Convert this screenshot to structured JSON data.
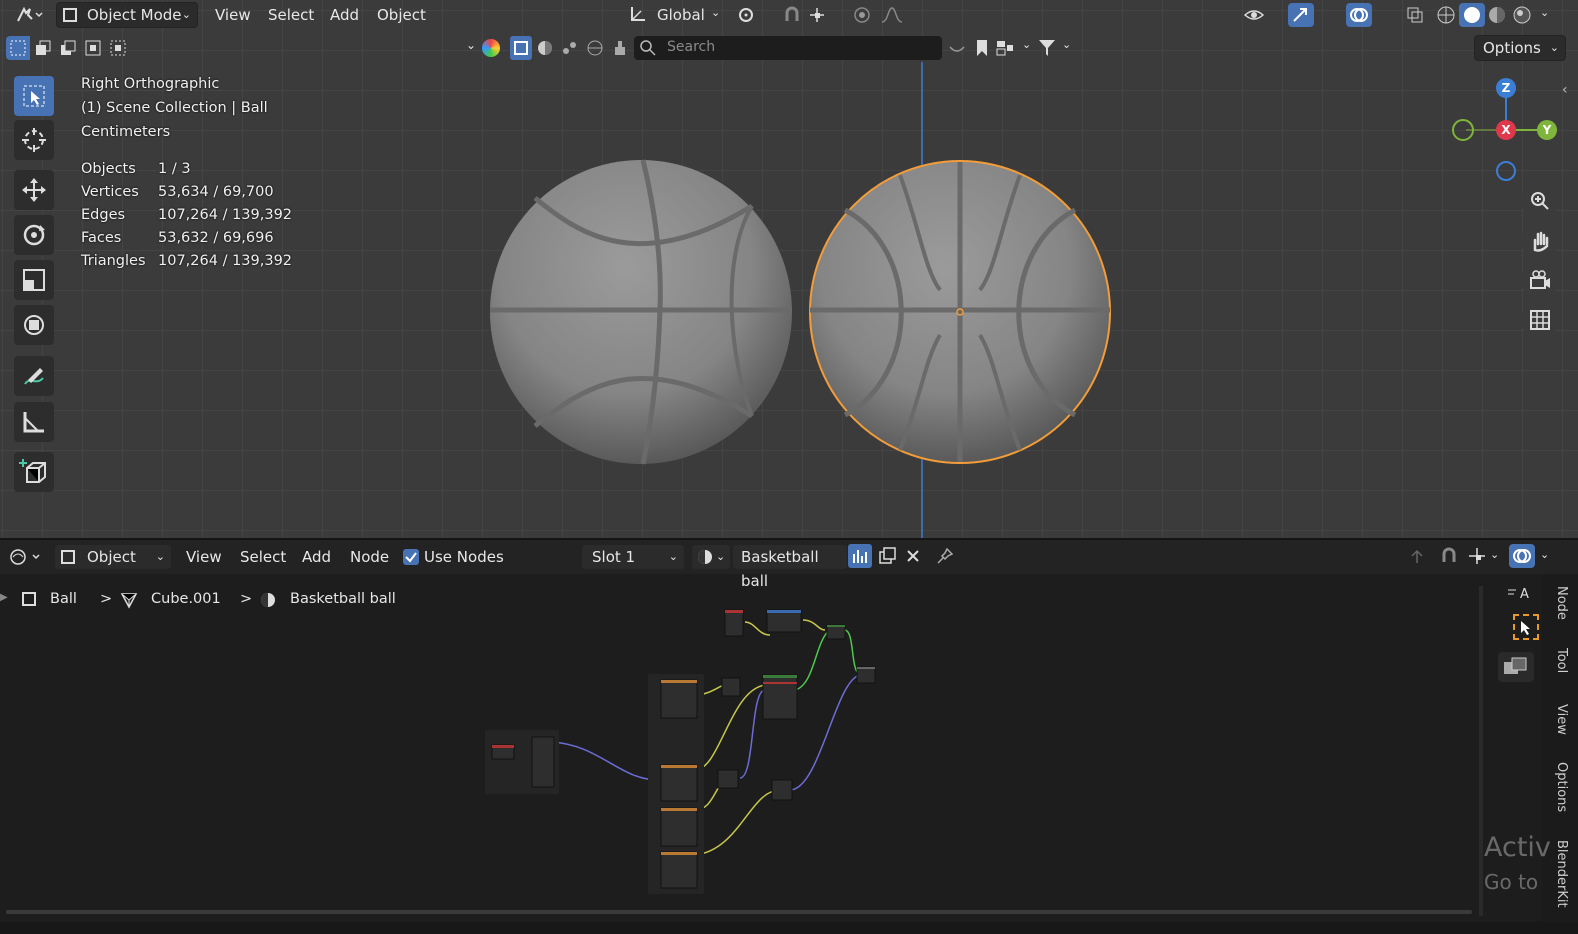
{
  "viewport": {
    "header": {
      "mode": "Object Mode",
      "menus": [
        "View",
        "Select",
        "Add",
        "Object"
      ],
      "orientation": "Global",
      "options_label": "Options",
      "search_placeholder": "Search"
    },
    "overlay": {
      "view_name": "Right Orthographic",
      "collection": "(1) Scene Collection | Ball",
      "units": "Centimeters",
      "stats": [
        {
          "label": "Objects",
          "value": "1 / 3"
        },
        {
          "label": "Vertices",
          "value": "53,634 / 69,700"
        },
        {
          "label": "Edges",
          "value": "107,264 / 139,392"
        },
        {
          "label": "Faces",
          "value": "53,632 / 69,696"
        },
        {
          "label": "Triangles",
          "value": "107,264 / 139,392"
        }
      ]
    },
    "gizmo": {
      "z": "Z",
      "x": "X",
      "y": "Y"
    },
    "colors": {
      "selection": "#f29c3a",
      "active_tool": "#4772b3",
      "axis_x": "#e0384b",
      "axis_y": "#7fb53a",
      "axis_z": "#3b7ed6"
    }
  },
  "node_editor": {
    "header": {
      "context": "Object",
      "menus": [
        "View",
        "Select",
        "Add",
        "Node"
      ],
      "use_nodes_label": "Use Nodes",
      "use_nodes_checked": true,
      "slot": "Slot 1",
      "material": "Basketball ball"
    },
    "breadcrumb": {
      "object": "Ball",
      "mesh": "Cube.001",
      "material": "Basketball ball",
      "separator": ">"
    },
    "side_tabs": [
      "Node",
      "Tool",
      "View",
      "Options",
      "BlenderKit"
    ],
    "watermark": {
      "line1": "Activ",
      "line2": "Go to"
    }
  }
}
